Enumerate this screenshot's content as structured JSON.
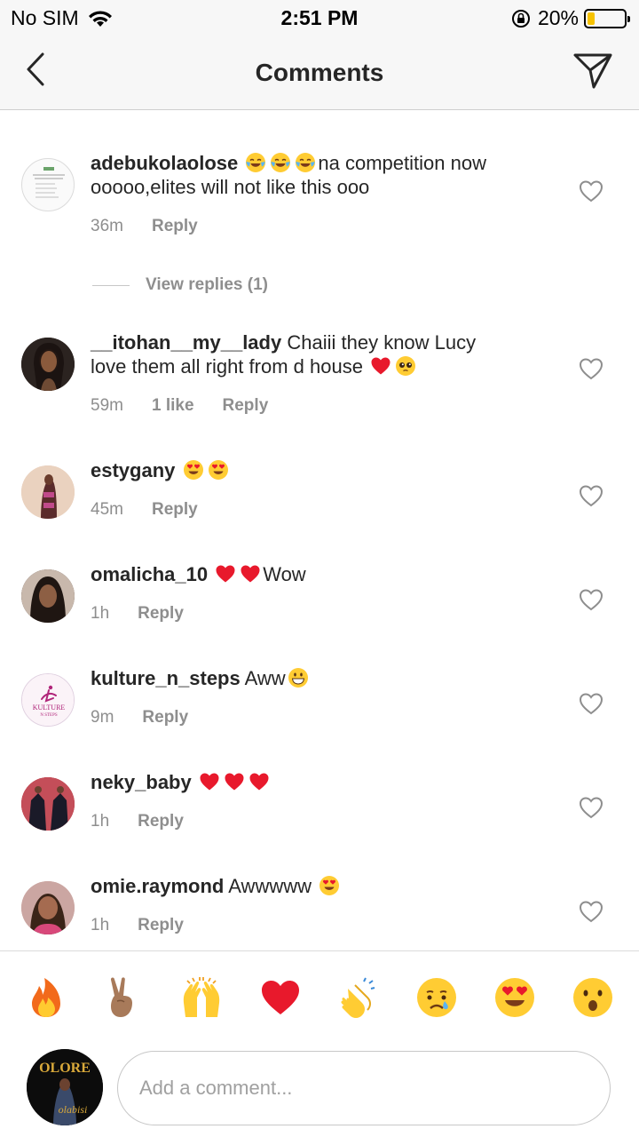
{
  "status_bar": {
    "carrier": "No SIM",
    "time": "2:51 PM",
    "battery": "20%",
    "battery_level": 0.2
  },
  "header": {
    "title": "Comments"
  },
  "comments": [
    {
      "username": "adebukolaolose",
      "text_line1": "na competition now",
      "text_line2": "ooooo,elites will not like this ooo",
      "time": "36m",
      "reply_label": "Reply",
      "view_replies": "View replies (1)"
    },
    {
      "username": "__itohan__my__lady",
      "text_line1": "Chaiii they know Lucy",
      "text_line2": "love them all right from d house",
      "time": "59m",
      "likes": "1 like",
      "reply_label": "Reply"
    },
    {
      "username": "estygany",
      "text": "",
      "time": "45m",
      "reply_label": "Reply"
    },
    {
      "username": "omalicha_10",
      "text": "Wow",
      "time": "1h",
      "reply_label": "Reply"
    },
    {
      "username": "kulture_n_steps",
      "text": "Aww",
      "time": "9m",
      "reply_label": "Reply",
      "avatar_text_1": "KULTURE",
      "avatar_text_2": "N STEPS"
    },
    {
      "username": "neky_baby",
      "text": "",
      "time": "1h",
      "reply_label": "Reply"
    },
    {
      "username": "omie.raymond",
      "text": "Awwwww",
      "time": "1h",
      "reply_label": "Reply"
    }
  ],
  "quick_reactions": [
    "fire",
    "victory-hand",
    "raising-hands",
    "red-heart",
    "clapping-hands",
    "crying-face",
    "heart-eyes",
    "surprised-face"
  ],
  "composer": {
    "placeholder": "Add a comment...",
    "avatar_text": "OLORE",
    "avatar_signature": "olabisi"
  },
  "colors": {
    "text": "#262626",
    "secondary": "#8e8e8e",
    "heart_red": "#e8192c",
    "battery_yellow": "#f6c200",
    "bar_bg": "#f7f7f7"
  }
}
